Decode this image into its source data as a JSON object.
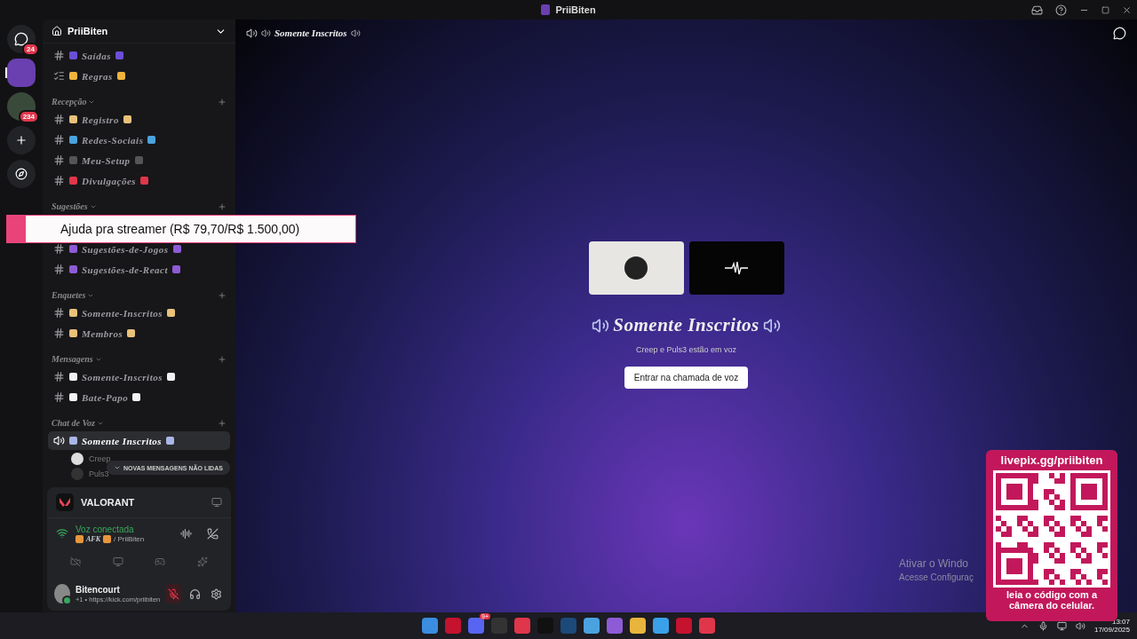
{
  "titlebar": {
    "title": "PriiBiten"
  },
  "servers": [
    {
      "kind": "home",
      "badge": "24",
      "selected": false
    },
    {
      "kind": "server",
      "selected": true
    },
    {
      "kind": "folder",
      "badge": "234",
      "selected": false
    },
    {
      "kind": "add",
      "selected": false
    },
    {
      "kind": "discover",
      "selected": false
    }
  ],
  "server_name": "PriiBiten",
  "channel_groups": [
    {
      "channels": [
        {
          "kind": "text",
          "name": "Saídas",
          "color": "#6b4fd8",
          "selected": false
        },
        {
          "kind": "rules",
          "name": "Regras",
          "color": "#f0b43c",
          "selected": false
        }
      ]
    },
    {
      "name": "Recepção",
      "channels": [
        {
          "kind": "text",
          "name": "Registro",
          "color": "#e8c27a",
          "selected": false
        },
        {
          "kind": "text",
          "name": "Redes-Sociais",
          "color": "#4aa3df",
          "selected": false
        },
        {
          "kind": "text",
          "name": "Meu-Setup",
          "color": "#555555",
          "selected": false
        },
        {
          "kind": "text",
          "name": "Divulgações",
          "color": "#e0364b",
          "selected": false
        }
      ]
    },
    {
      "name": "Sugestões",
      "channels": [
        {
          "kind": "text",
          "name": "Sugestões-de-Jogos",
          "color": "#8e5bd6",
          "selected": false
        },
        {
          "kind": "text",
          "name": "Sugestões-de-React",
          "color": "#8e5bd6",
          "selected": false
        }
      ]
    },
    {
      "name": "Enquetes",
      "channels": [
        {
          "kind": "text",
          "name": "Somente-Inscritos",
          "color": "#e8c27a",
          "selected": false
        },
        {
          "kind": "text",
          "name": "Membros",
          "color": "#e8c27a",
          "selected": false
        }
      ]
    },
    {
      "name": "Mensagens",
      "channels": [
        {
          "kind": "text",
          "name": "Somente-Inscritos",
          "color": "#f2f2f2",
          "selected": false
        },
        {
          "kind": "text",
          "name": "Bate-Papo",
          "color": "#f2f2f2",
          "selected": false
        }
      ]
    },
    {
      "name": "Chat de Voz",
      "channels": [
        {
          "kind": "voice",
          "name": "Somente Inscritos",
          "color": "#a9b7e6",
          "selected": true
        }
      ]
    }
  ],
  "voice_users": [
    "Creep",
    "Puls3"
  ],
  "unread_pill": "NOVAS MENSAGENS NÃO LIDAS",
  "activity": {
    "game": "VALORANT"
  },
  "voice": {
    "status": "Voz conectada",
    "channel": "AFK",
    "server": "/ PriiBiten"
  },
  "user": {
    "name": "Bitencourt",
    "status": "+1 • https://kick.com/priibiten",
    "mic_muted": true
  },
  "main": {
    "channel": "Somente Inscritos",
    "title": "Somente Inscritos",
    "subtitle": "Creep e Puls3 estão em voz",
    "join_button": "Entrar na chamada de voz"
  },
  "donation": {
    "text": "Ajuda pra streamer (R$ 79,70/R$ 1.500,00)",
    "level": 0.053
  },
  "qr_widget": {
    "url": "livepix.gg/priibiten",
    "caption": "leia o código com a câmera do celular."
  },
  "activation": {
    "line_1": "Ativar o Windo",
    "line_2": "Acesse Configuraç"
  },
  "taskbar": {
    "discord_badge": "9+",
    "time": "13:07",
    "date": "17/09/2025"
  }
}
